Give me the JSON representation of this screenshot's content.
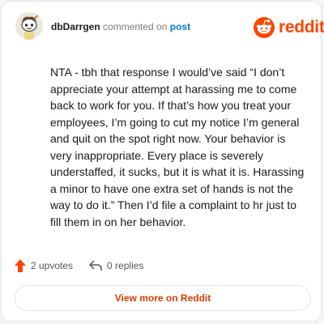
{
  "header": {
    "username": "dbDarrgen",
    "action": "commented on",
    "post_link": "post",
    "brand": "reddit",
    "avatar_icon": "snoo-avatar-icon",
    "brand_icon": "reddit-logo-icon"
  },
  "comment": {
    "body": "NTA - tbh that response I would’ve said “I don’t appreciate your attempt at harassing me to come back to work for you. If that’s how you treat your employees, I’m going to cut my notice I’m general and quit on the spot right now. Your behavior is very inappropriate. Every place is severely understaffed, it sucks, but it is what it is. Harassing a minor to have one extra set of hands is not the way to do it.” Then I’d file a complaint to hr just to fill them in on her behavior."
  },
  "stats": {
    "upvotes": "2 upvotes",
    "replies": "0 replies",
    "upvote_icon": "upvote-arrow-icon",
    "reply_icon": "reply-arrow-icon"
  },
  "footer": {
    "view_more": "View more on Reddit"
  },
  "colors": {
    "brand": "#ff4500",
    "link": "#0079d3",
    "button_text": "#d93a00",
    "card_border": "#e3e5e7"
  }
}
